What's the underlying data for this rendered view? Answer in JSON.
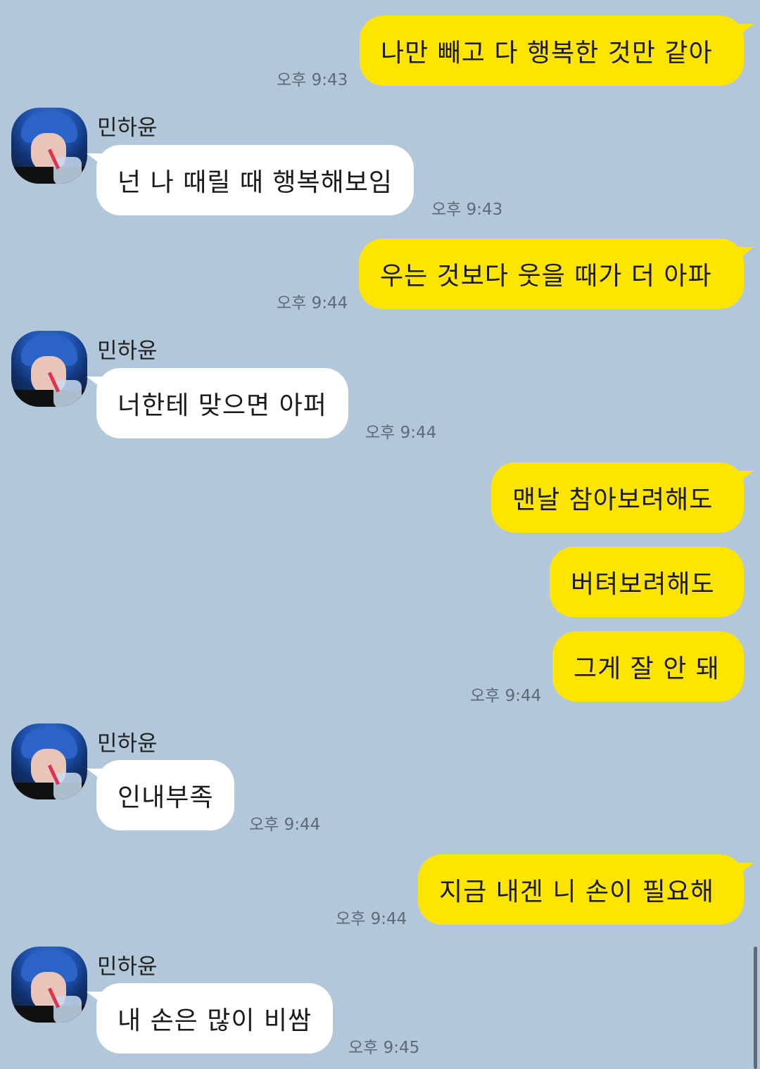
{
  "contact": {
    "name": "민하윤"
  },
  "messages": [
    {
      "from": "me",
      "text": "나만 빼고 다 행복한 것만 같아",
      "time": "오후 9:43"
    },
    {
      "from": "other",
      "text": "넌 나 때릴 때 행복해보임",
      "time": "오후 9:43"
    },
    {
      "from": "me",
      "text": "우는 것보다 웃을 때가 더 아파",
      "time": "오후 9:44"
    },
    {
      "from": "other",
      "text": "너한테 맞으면 아퍼",
      "time": "오후 9:44"
    },
    {
      "from": "me",
      "text": "맨날 참아보려해도",
      "time": ""
    },
    {
      "from": "me",
      "text": "버텨보려해도",
      "time": ""
    },
    {
      "from": "me",
      "text": "그게 잘 안 돼",
      "time": "오후 9:44"
    },
    {
      "from": "other",
      "text": "인내부족",
      "time": "오후 9:44"
    },
    {
      "from": "me",
      "text": "지금 내겐 니 손이 필요해",
      "time": "오후 9:44"
    },
    {
      "from": "other",
      "text": "내 손은 많이 비쌈",
      "time": "오후 9:45"
    }
  ],
  "colors": {
    "background": "#b2c7da",
    "my_bubble": "#fee500",
    "other_bubble": "#ffffff"
  }
}
